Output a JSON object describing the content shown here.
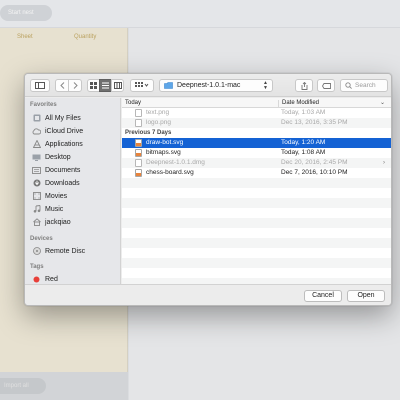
{
  "background": {
    "start_button": "Start nest",
    "col_sheet": "Sheet",
    "col_quantity": "Quantity",
    "bottom_button": "Import all"
  },
  "dialog": {
    "location": "Deepnest-1.0.1-mac",
    "search_placeholder": "Search",
    "sidebar": {
      "favorites_header": "Favorites",
      "favorites": [
        {
          "label": "All My Files",
          "icon": "all-files-icon"
        },
        {
          "label": "iCloud Drive",
          "icon": "cloud-icon"
        },
        {
          "label": "Applications",
          "icon": "applications-icon"
        },
        {
          "label": "Desktop",
          "icon": "desktop-icon"
        },
        {
          "label": "Documents",
          "icon": "documents-icon"
        },
        {
          "label": "Downloads",
          "icon": "downloads-icon"
        },
        {
          "label": "Movies",
          "icon": "movies-icon"
        },
        {
          "label": "Music",
          "icon": "music-icon"
        },
        {
          "label": "jackqiao",
          "icon": "home-icon"
        }
      ],
      "devices_header": "Devices",
      "devices": [
        {
          "label": "Remote Disc",
          "icon": "disc-icon"
        }
      ],
      "tags_header": "Tags",
      "tags": [
        {
          "label": "Red",
          "color": "#e8403a"
        }
      ]
    },
    "columns": {
      "name": "Today",
      "date": "Date Modified"
    },
    "files_today": [
      {
        "name": "text.png",
        "date": "Today, 1:03 AM"
      },
      {
        "name": "logo.png",
        "date": "Dec 13, 2016, 3:35 PM"
      }
    ],
    "section_previous": "Previous 7 Days",
    "files_previous": [
      {
        "name": "draw-bot.svg",
        "date": "Today, 1:20 AM"
      },
      {
        "name": "bitmaps.svg",
        "date": "Today, 1:08 AM"
      },
      {
        "name": "Deepnest-1.0.1.dmg",
        "date": "Dec 20, 2016, 2:45 PM"
      },
      {
        "name": "chess-board.svg",
        "date": "Dec 7, 2016, 10:10 PM"
      }
    ],
    "buttons": {
      "cancel": "Cancel",
      "open": "Open"
    }
  },
  "colors": {
    "selection": "#1462d4",
    "tag_red": "#e8403a"
  }
}
